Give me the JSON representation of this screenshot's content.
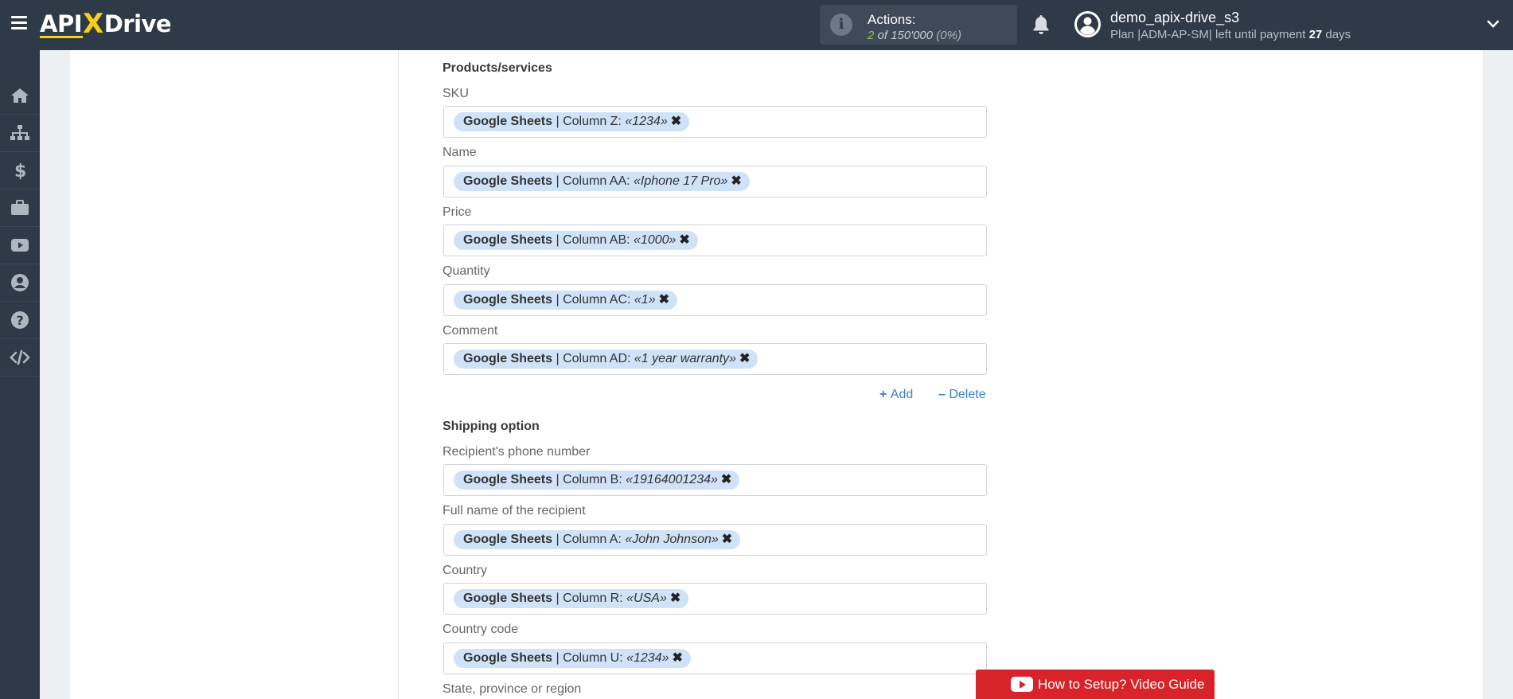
{
  "header": {
    "logo_left": "API",
    "logo_x": "X",
    "logo_right": "Drive",
    "actions_label": "Actions:",
    "actions_used": "2",
    "actions_of": "of",
    "actions_total": "150'000",
    "actions_pct": "(0%)",
    "username": "demo_apix-drive_s3",
    "plan_prefix": "Plan |ADM-AP-SM| left until payment",
    "plan_days": "27",
    "plan_suffix": "days"
  },
  "sections": {
    "products": "Products/services",
    "shipping": "Shipping option"
  },
  "fields": [
    {
      "label": "SKU",
      "source": "Google Sheets",
      "column": " | Column Z: ",
      "value": "«1234»"
    },
    {
      "label": "Name",
      "source": "Google Sheets",
      "column": " | Column AA: ",
      "value": "«Iphone 17 Pro»"
    },
    {
      "label": "Price",
      "source": "Google Sheets",
      "column": " | Column AB: ",
      "value": "«1000»"
    },
    {
      "label": "Quantity",
      "source": "Google Sheets",
      "column": " | Column AC: ",
      "value": "«1»"
    },
    {
      "label": "Comment",
      "source": "Google Sheets",
      "column": " | Column AD: ",
      "value": "«1 year warranty»"
    },
    {
      "label": "Recipient's phone number",
      "source": "Google Sheets",
      "column": " | Column B: ",
      "value": "«19164001234»"
    },
    {
      "label": "Full name of the recipient",
      "source": "Google Sheets",
      "column": " | Column A: ",
      "value": "«John Johnson»"
    },
    {
      "label": "Country",
      "source": "Google Sheets",
      "column": " | Column R: ",
      "value": "«USA»"
    },
    {
      "label": "Country code",
      "source": "Google Sheets",
      "column": " | Column U: ",
      "value": "«1234»"
    },
    {
      "label": "State, province or region"
    }
  ],
  "chip_remove": "✖",
  "links": {
    "add": "Add",
    "delete": "Delete"
  },
  "video_guide": "How to Setup? Video Guide"
}
